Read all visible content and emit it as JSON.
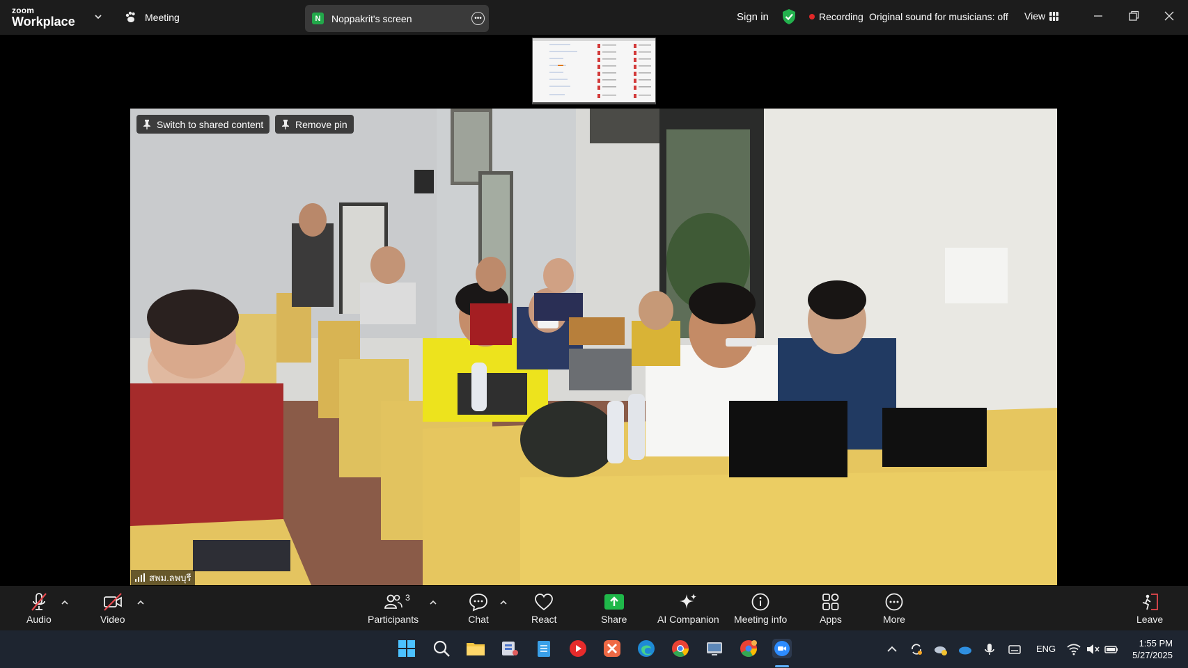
{
  "app": {
    "brand_small": "zoom",
    "brand_large": "Workplace"
  },
  "topbar": {
    "meeting_label": "Meeting",
    "share_badge": "N",
    "share_name": "Noppakrit's screen",
    "sign_in": "Sign in",
    "recording": "Recording",
    "original_sound": "Original sound for musicians: off",
    "view": "View"
  },
  "video": {
    "switch_btn": "Switch to shared content",
    "remove_pin_btn": "Remove pin",
    "participant_name": "สพม.ลพบุรี"
  },
  "toolbar": {
    "audio": "Audio",
    "video": "Video",
    "participants": "Participants",
    "participant_count": "3",
    "chat": "Chat",
    "react": "React",
    "share": "Share",
    "ai_companion": "AI Companion",
    "meeting_info": "Meeting info",
    "apps": "Apps",
    "more": "More",
    "leave": "Leave"
  },
  "taskbar": {
    "language": "ENG",
    "time": "1:55 PM",
    "date": "5/27/2025"
  },
  "colors": {
    "share_green": "#1fb84a",
    "recording_red": "#e02828",
    "leave_red": "#e5484d",
    "shield_green": "#23b14d"
  }
}
